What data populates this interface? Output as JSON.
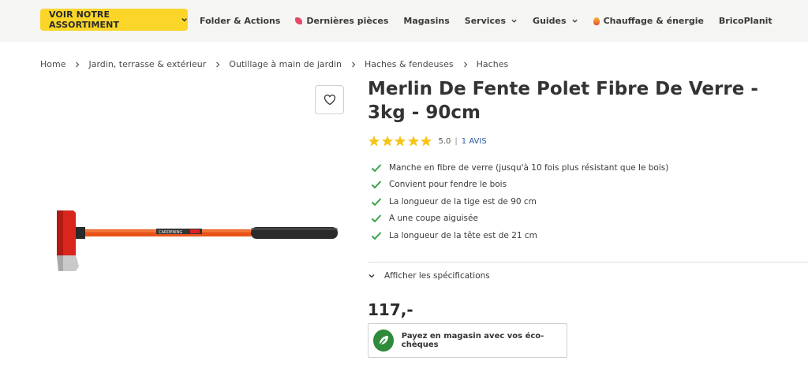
{
  "nav": {
    "cta_label": "VOIR NOTRE ASSORTIMENT",
    "links": [
      {
        "label": "Folder & Actions"
      },
      {
        "label": "Dernières pièces"
      },
      {
        "label": "Magasins"
      },
      {
        "label": "Services"
      },
      {
        "label": "Guides"
      },
      {
        "label": "Chauffage & énergie"
      },
      {
        "label": "BricoPlanit"
      }
    ]
  },
  "breadcrumb": [
    "Home",
    "Jardin, terrasse & extérieur",
    "Outillage à main de jardin",
    "Haches & fendeuses",
    "Haches"
  ],
  "product": {
    "title": "Merlin De Fente Polet Fibre De Verre - 3kg - 90cm",
    "rating_value": "5.0",
    "rating_stars": 5,
    "reviews_label": "1 AVIS",
    "features": [
      "Manche en fibre de verre (jusqu'à 10 fois plus résistant que le bois)",
      "Convient pour fendre le bois",
      "La longueur de la tige est de 90 cm",
      "A une coupe aiguisée",
      "La longueur de la tête est de 21 cm"
    ],
    "specs_toggle": "Afficher les spécifications",
    "price": "117,-",
    "eco_label": "Payez en magasin avec vos éco-chèques",
    "handle_label": "CARDENING"
  },
  "colors": {
    "accent_yellow": "#fbd628",
    "check_green": "#3aa14a",
    "star_yellow": "#f5c518",
    "eco_green": "#2e8b3a",
    "link_blue": "#2d5aa0"
  }
}
